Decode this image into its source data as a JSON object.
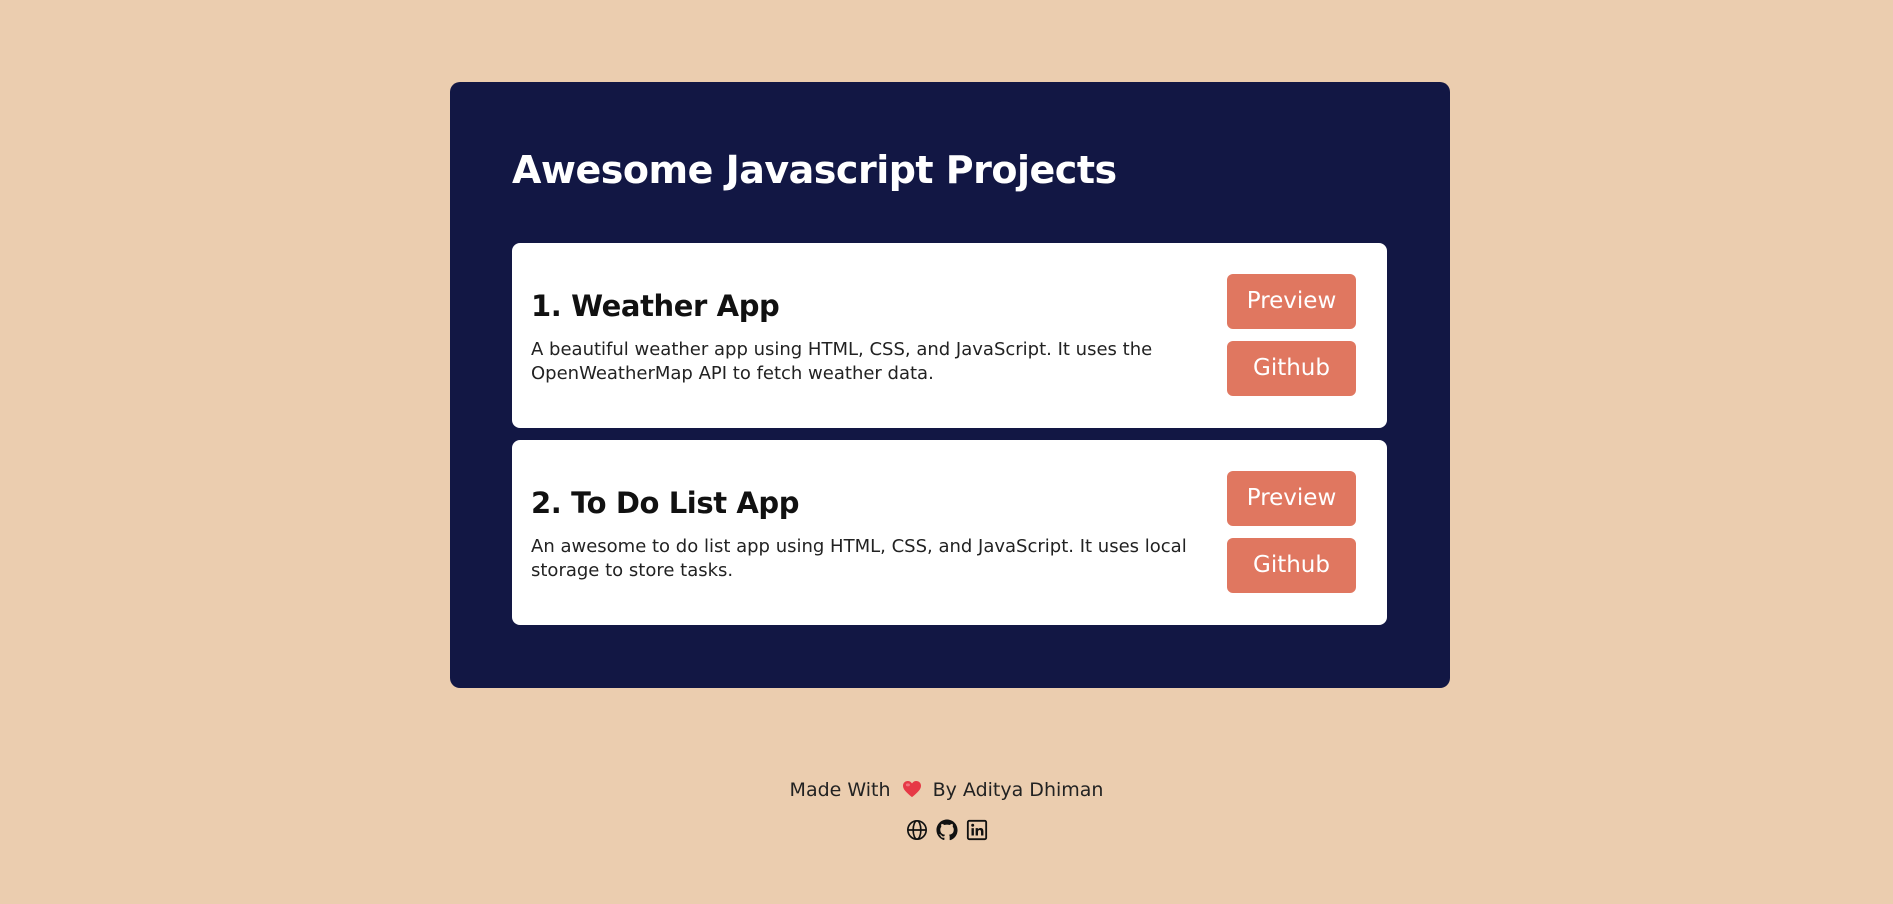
{
  "page": {
    "title": "Awesome Javascript Projects"
  },
  "projects": [
    {
      "title": "1. Weather App",
      "description": "A beautiful weather app using HTML, CSS, and JavaScript. It uses the OpenWeatherMap API to fetch weather data.",
      "preview_label": "Preview",
      "github_label": "Github"
    },
    {
      "title": "2. To Do List App",
      "description": "An awesome to do list app using HTML, CSS, and JavaScript. It uses local storage to store tasks.",
      "preview_label": "Preview",
      "github_label": "Github"
    }
  ],
  "footer": {
    "made_with": "Made With",
    "heart_icon": "heart-icon",
    "by": "By Aditya Dhiman",
    "social_icons": [
      "globe-icon",
      "github-icon",
      "linkedin-icon"
    ]
  },
  "colors": {
    "background": "#ebcdaf",
    "panel": "#121744",
    "button": "#e07760",
    "heart": "#e63946"
  }
}
